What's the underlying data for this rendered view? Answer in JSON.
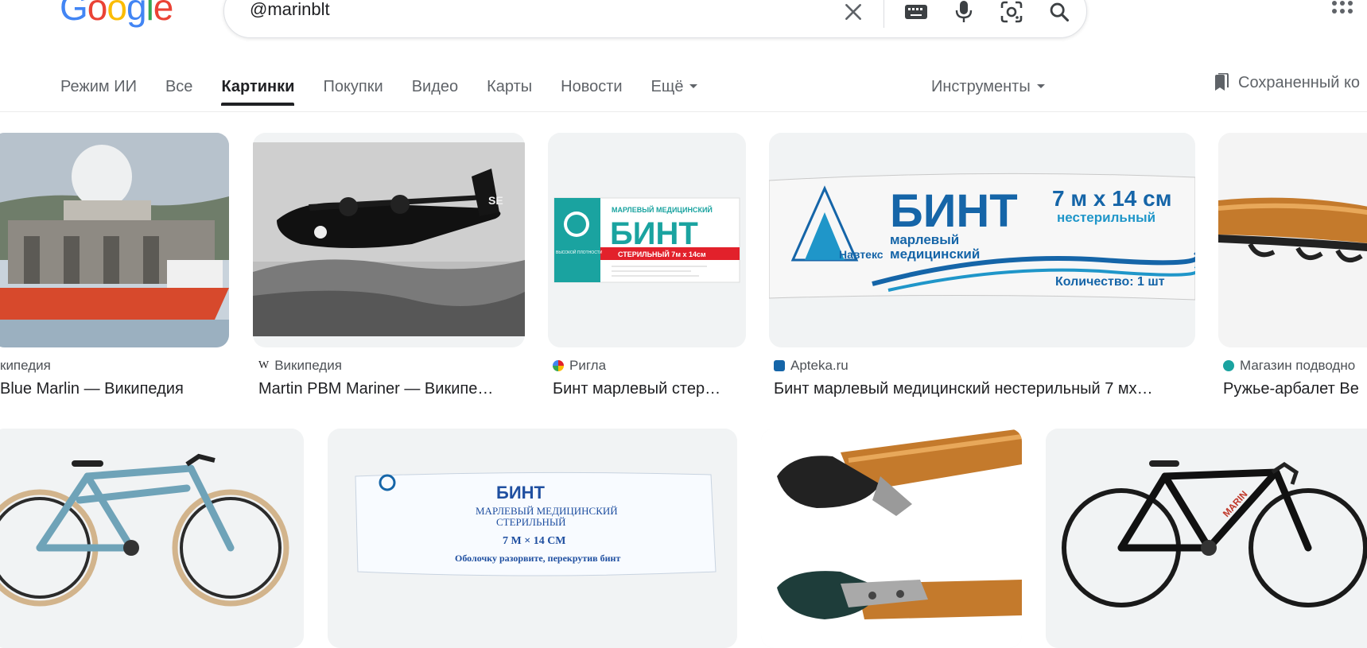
{
  "header": {
    "logo_text": "Google",
    "search_query": "@marinblt",
    "icons": [
      "close-icon",
      "keyboard-icon",
      "microphone-icon",
      "lens-icon",
      "search-icon"
    ]
  },
  "tabs": [
    {
      "label": "Режим ИИ",
      "active": false
    },
    {
      "label": "Все",
      "active": false
    },
    {
      "label": "Картинки",
      "active": true
    },
    {
      "label": "Покупки",
      "active": false
    },
    {
      "label": "Видео",
      "active": false
    },
    {
      "label": "Карты",
      "active": false
    },
    {
      "label": "Новости",
      "active": false
    },
    {
      "label": "Ещё",
      "active": false
    }
  ],
  "tools_label": "Инструменты",
  "saved_label": "Сохраненный ко",
  "results_row1": [
    {
      "source": "кипедия",
      "caption": "Blue Marlin — Википедия"
    },
    {
      "source": "Википедия",
      "caption": "Martin PBM Mariner — Википе…"
    },
    {
      "source": "Ригла",
      "caption": "Бинт марлевый стер…"
    },
    {
      "source": "Apteka.ru",
      "caption": "Бинт марлевый медицинский нестерильный 7 мх…"
    },
    {
      "source": "Магазин подводно",
      "caption": "Ружье-арбалет Be"
    }
  ],
  "image_texts": {
    "plane_marking": "SE",
    "bandage1_top": "МАРЛЕВЫЙ МЕДИЦИНСКИЙ",
    "bandage1_main": "БИНТ",
    "bandage1_sub": "СТЕРИЛЬНЫЙ 7м х 14см",
    "bandage1_left": "ВЫСОКОЙ ПЛОТНОСТИ",
    "bandage2_main": "БИНТ",
    "bandage2_size": "7 м х 14 см",
    "bandage2_type": "нестерильный",
    "bandage2_desc1": "марлевый",
    "bandage2_desc2": "медицинский",
    "bandage2_brand": "Навтекс",
    "bandage2_qty": "Количество: 1 шт",
    "bandage3_main": "БИНТ",
    "bandage3_desc1": "МАРЛЕВЫЙ МЕДИЦИНСКИЙ",
    "bandage3_desc2": "СТЕРИЛЬНЫЙ",
    "bandage3_size": "7 М × 14 СМ",
    "bandage3_note": "Оболочку разорвите, перекрутив бинт"
  },
  "colors": {
    "accent_active_tab": "#202124",
    "muted_text": "#5f6368",
    "bandage_teal": "#1aa3a0",
    "bandage_red": "#e2212b",
    "bandage_blue": "#1565a8"
  }
}
